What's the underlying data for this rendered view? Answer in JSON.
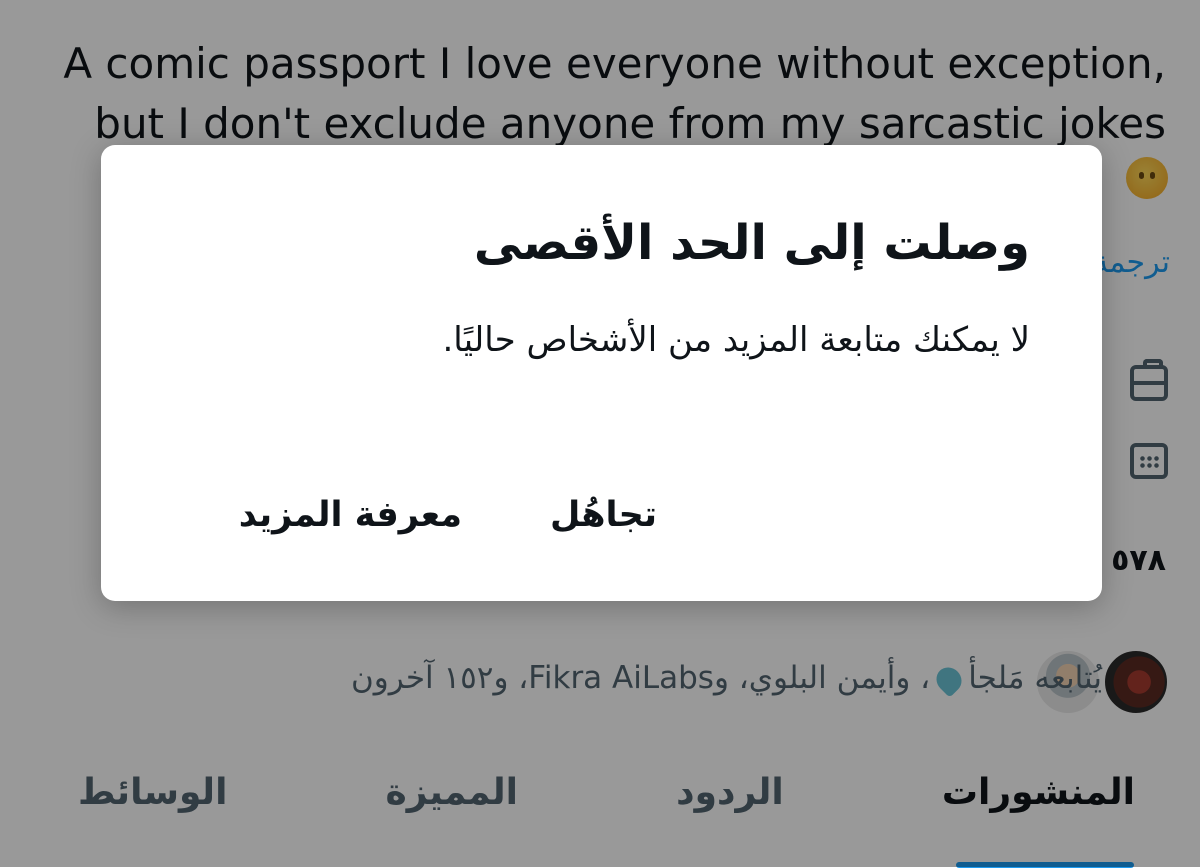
{
  "profile": {
    "bio_line1": "A comic passport I love everyone without exception,",
    "bio_line2": "but I don't exclude anyone from my sarcastic jokes",
    "translate_link": "ترجمة",
    "count_fragment": "٥٧٨",
    "followed_by": "يُتابعه مَلجأ",
    "followed_by_rest": "، وأيمن البلوي، وFikra AiLabs، و١٥٢ آخرون"
  },
  "tabs": [
    {
      "label": "المنشورات",
      "active": true
    },
    {
      "label": "الردود",
      "active": false
    },
    {
      "label": "المميزة",
      "active": false
    },
    {
      "label": "الوسائط",
      "active": false
    }
  ],
  "dialog": {
    "title": "وصلت إلى الحد الأقصى",
    "body": "لا يمكنك متابعة المزيد من الأشخاص حاليًا.",
    "ignore_label": "تجاهُل",
    "learn_more_label": "معرفة المزيد"
  },
  "colors": {
    "accent": "#1d9bf0",
    "text_primary": "#0f1419",
    "text_secondary": "#536471",
    "overlay": "rgba(0,0,0,0.40)"
  },
  "icons": [
    "briefcase-icon",
    "calendar-icon",
    "heart-emoji-icon",
    "salute-emoji-icon"
  ]
}
